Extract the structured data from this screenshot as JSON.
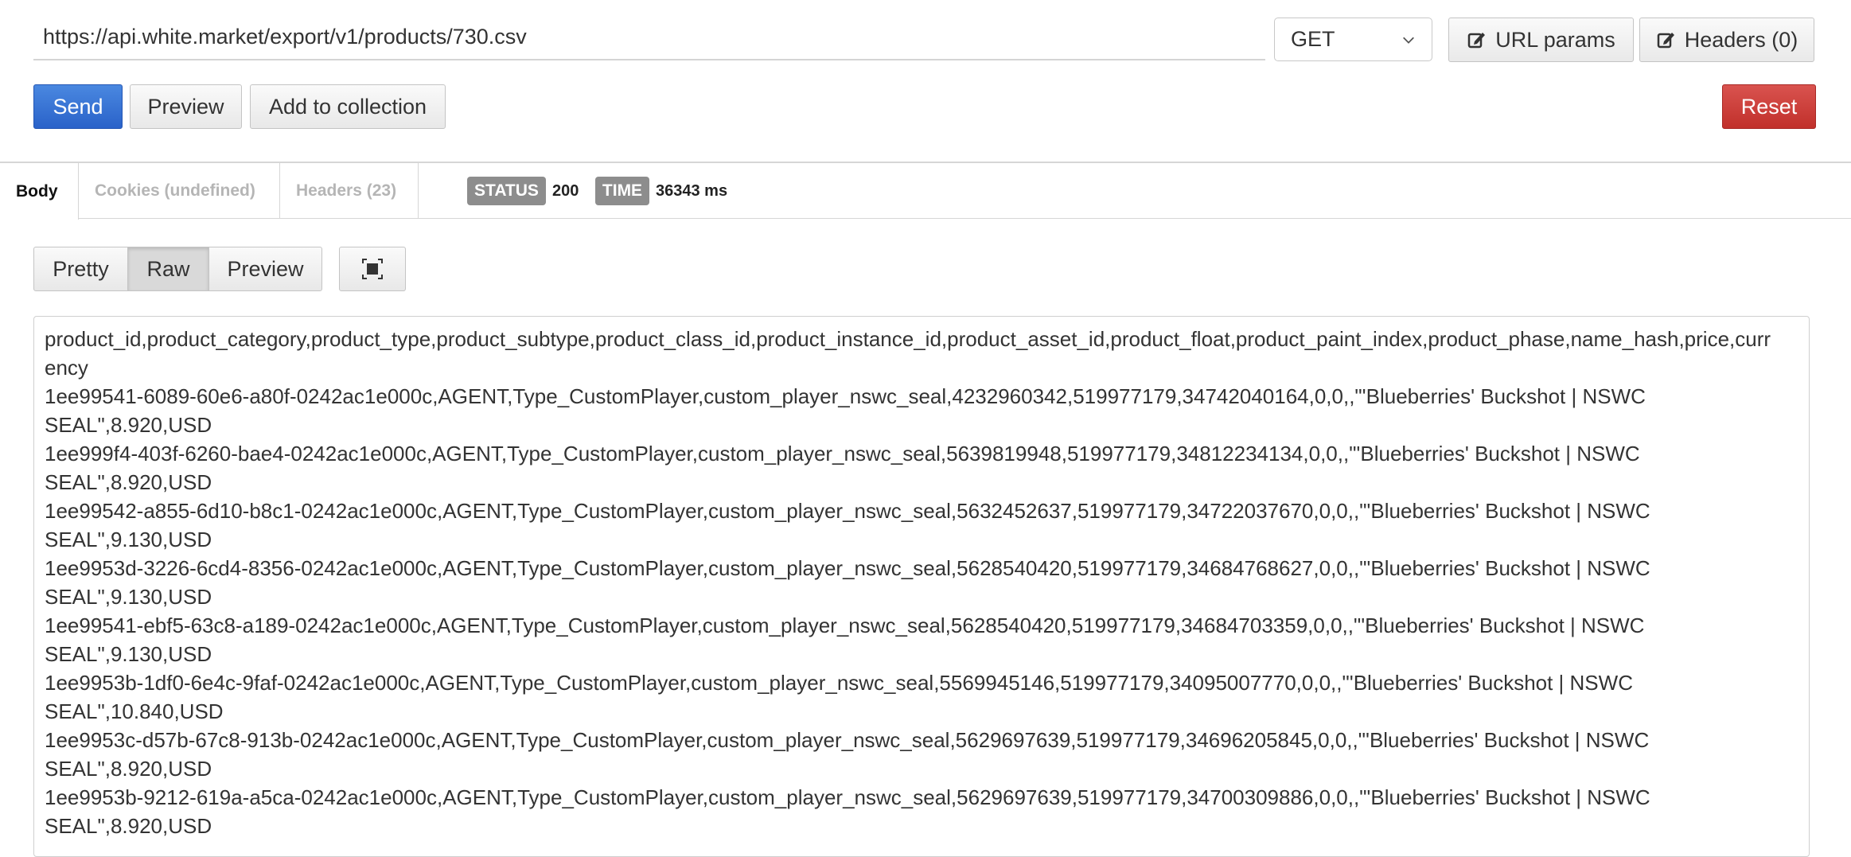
{
  "request": {
    "url": "https://api.white.market/export/v1/products/730.csv",
    "method": "GET",
    "url_params_label": "URL params",
    "headers_label": "Headers (0)",
    "send_label": "Send",
    "preview_label": "Preview",
    "add_collection_label": "Add to collection",
    "reset_label": "Reset"
  },
  "response": {
    "tabs": {
      "body": "Body",
      "cookies": "Cookies (undefined)",
      "headers": "Headers (23)"
    },
    "status_label": "STATUS",
    "status_value": "200",
    "time_label": "TIME",
    "time_value": "36343 ms",
    "views": {
      "pretty": "Pretty",
      "raw": "Raw",
      "preview": "Preview",
      "active": "raw"
    },
    "body_lines": [
      "product_id,product_category,product_type,product_subtype,product_class_id,product_instance_id,product_asset_id,product_float,product_paint_index,product_phase,name_hash,price,curr\nency",
      "1ee99541-6089-60e6-a80f-0242ac1e000c,AGENT,Type_CustomPlayer,custom_player_nswc_seal,4232960342,519977179,34742040164,0,0,,\"'Blueberries' Buckshot | NSWC\nSEAL\",8.920,USD",
      "1ee999f4-403f-6260-bae4-0242ac1e000c,AGENT,Type_CustomPlayer,custom_player_nswc_seal,5639819948,519977179,34812234134,0,0,,\"'Blueberries' Buckshot | NSWC\nSEAL\",8.920,USD",
      "1ee99542-a855-6d10-b8c1-0242ac1e000c,AGENT,Type_CustomPlayer,custom_player_nswc_seal,5632452637,519977179,34722037670,0,0,,\"'Blueberries' Buckshot | NSWC\nSEAL\",9.130,USD",
      "1ee9953d-3226-6cd4-8356-0242ac1e000c,AGENT,Type_CustomPlayer,custom_player_nswc_seal,5628540420,519977179,34684768627,0,0,,\"'Blueberries' Buckshot | NSWC\nSEAL\",9.130,USD",
      "1ee99541-ebf5-63c8-a189-0242ac1e000c,AGENT,Type_CustomPlayer,custom_player_nswc_seal,5628540420,519977179,34684703359,0,0,,\"'Blueberries' Buckshot | NSWC\nSEAL\",9.130,USD",
      "1ee9953b-1df0-6e4c-9faf-0242ac1e000c,AGENT,Type_CustomPlayer,custom_player_nswc_seal,5569945146,519977179,34095007770,0,0,,\"'Blueberries' Buckshot | NSWC\nSEAL\",10.840,USD",
      "1ee9953c-d57b-67c8-913b-0242ac1e000c,AGENT,Type_CustomPlayer,custom_player_nswc_seal,5629697639,519977179,34696205845,0,0,,\"'Blueberries' Buckshot | NSWC\nSEAL\",8.920,USD",
      "1ee9953b-9212-619a-a5ca-0242ac1e000c,AGENT,Type_CustomPlayer,custom_player_nswc_seal,5629697639,519977179,34700309886,0,0,,\"'Blueberries' Buckshot | NSWC\nSEAL\",8.920,USD"
    ]
  },
  "icons": {
    "method_dropdown": "chevron-down-icon",
    "url_params": "edit-icon",
    "headers": "edit-icon",
    "fullscreen": "fullscreen-icon"
  },
  "colors": {
    "send_button": "#2a62c9",
    "reset_button": "#c1302b",
    "badge": "#8d8d8d"
  }
}
